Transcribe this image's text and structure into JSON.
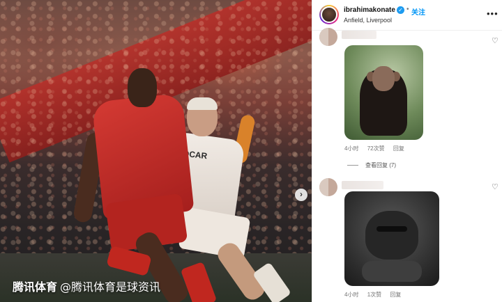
{
  "post": {
    "username": "ibrahimakonate",
    "follow_label": "关注",
    "separator": "•",
    "location": "Anfield, Liverpool",
    "more_icon": "more-horizontal-icon",
    "verified_icon": "verified-badge-icon"
  },
  "photo": {
    "sponsor_text": "SOCAR",
    "next_icon": "chevron-right-icon",
    "watermark_brand": "腾讯体育",
    "watermark_handle": "@腾讯体育是球资讯"
  },
  "comments": [
    {
      "sticker": "chimpanzee",
      "time": "4小时",
      "likes": "72次赞",
      "reply_label": "回复",
      "view_replies": "查看回复 (7)"
    },
    {
      "sticker": "gorilla",
      "time": "4小时",
      "likes": "1次赞",
      "reply_label": "回复"
    }
  ],
  "colors": {
    "follow": "#0095f6",
    "verified": "#1d9bf0",
    "meta_text": "#737373"
  }
}
